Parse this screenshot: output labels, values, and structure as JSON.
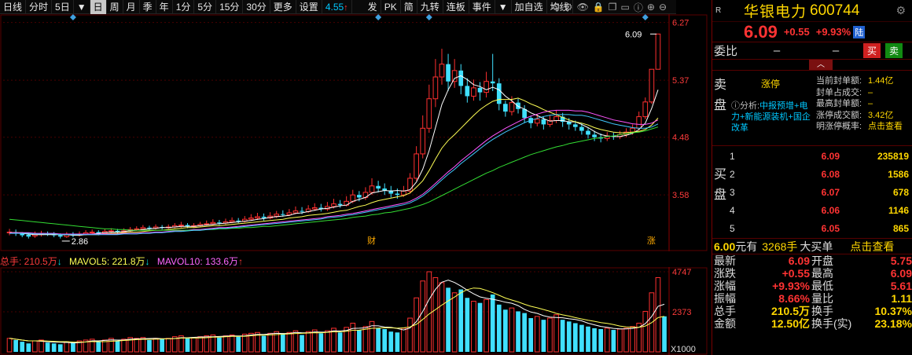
{
  "toolbar": {
    "items": [
      "日线",
      "分时",
      "5日",
      "日",
      "周",
      "月",
      "季",
      "年",
      "1分",
      "5分",
      "15分",
      "30分",
      "更多",
      "设置"
    ],
    "active": "日",
    "price": "4.55",
    "items2": [
      "发",
      "PK",
      "简",
      "九转",
      "连板",
      "事件",
      "加自选",
      "均线"
    ],
    "icons": [
      "settings-icon",
      "eye-icon",
      "lock-icon",
      "copy-icon",
      "comment-icon",
      "info-icon",
      "plus-icon",
      "minus-icon"
    ]
  },
  "chart": {
    "y_labels": [
      "6.27",
      "5.37",
      "4.48",
      "3.58"
    ],
    "high_label": "6.09",
    "low_label": "2.86",
    "event_cai": "财",
    "event_zt": "涨",
    "candles": [
      [
        2.99,
        3.0,
        2.95,
        3.05
      ],
      [
        3.0,
        2.98,
        2.94,
        3.04
      ],
      [
        2.98,
        2.95,
        2.92,
        3.0
      ],
      [
        2.96,
        2.93,
        2.9,
        2.99
      ],
      [
        2.94,
        2.96,
        2.91,
        3.01
      ],
      [
        2.96,
        2.98,
        2.93,
        3.02
      ],
      [
        2.98,
        2.97,
        2.94,
        3.01
      ],
      [
        2.97,
        2.95,
        2.92,
        3.0
      ],
      [
        2.95,
        2.93,
        2.9,
        2.98
      ],
      [
        2.93,
        2.96,
        2.91,
        3.0
      ],
      [
        2.96,
        2.95,
        2.92,
        3.0
      ],
      [
        2.95,
        2.97,
        2.93,
        3.01
      ],
      [
        2.97,
        2.99,
        2.95,
        3.03
      ],
      [
        2.99,
        3.0,
        2.96,
        3.04
      ],
      [
        3.0,
        2.98,
        2.95,
        3.03
      ],
      [
        2.98,
        3.01,
        2.96,
        3.05
      ],
      [
        3.01,
        3.02,
        2.99,
        3.06
      ],
      [
        3.02,
        3.0,
        2.97,
        3.05
      ],
      [
        3.0,
        3.02,
        2.98,
        3.06
      ],
      [
        3.02,
        3.04,
        3.0,
        3.08
      ],
      [
        3.04,
        3.05,
        3.02,
        3.09
      ],
      [
        3.05,
        3.07,
        3.03,
        3.11
      ],
      [
        3.07,
        3.06,
        3.03,
        3.1
      ],
      [
        3.06,
        3.08,
        3.04,
        3.12
      ],
      [
        3.08,
        3.07,
        3.04,
        3.11
      ],
      [
        3.07,
        3.08,
        3.05,
        3.12
      ],
      [
        3.08,
        3.1,
        3.06,
        3.14
      ],
      [
        3.1,
        3.11,
        3.07,
        3.16
      ],
      [
        3.11,
        3.09,
        3.06,
        3.14
      ],
      [
        3.09,
        3.1,
        3.07,
        3.14
      ],
      [
        3.1,
        3.12,
        3.08,
        3.16
      ],
      [
        3.12,
        3.13,
        3.1,
        3.18
      ],
      [
        3.13,
        3.15,
        3.11,
        3.2
      ],
      [
        3.15,
        3.14,
        3.11,
        3.19
      ],
      [
        3.14,
        3.16,
        3.12,
        3.21
      ],
      [
        3.16,
        3.18,
        3.14,
        3.23
      ],
      [
        3.18,
        3.17,
        3.14,
        3.22
      ],
      [
        3.17,
        3.2,
        3.15,
        3.25
      ],
      [
        3.2,
        3.22,
        3.18,
        3.28
      ],
      [
        3.22,
        3.24,
        3.19,
        3.3
      ],
      [
        3.24,
        3.22,
        3.18,
        3.29
      ],
      [
        3.22,
        3.25,
        3.2,
        3.31
      ],
      [
        3.25,
        3.28,
        3.22,
        3.33
      ],
      [
        3.28,
        3.27,
        3.24,
        3.34
      ],
      [
        3.27,
        3.3,
        3.25,
        3.36
      ],
      [
        3.3,
        3.33,
        3.28,
        3.4
      ],
      [
        3.33,
        3.32,
        3.28,
        3.39
      ],
      [
        3.32,
        3.36,
        3.3,
        3.42
      ],
      [
        3.36,
        3.38,
        3.33,
        3.45
      ],
      [
        3.38,
        3.36,
        3.32,
        3.44
      ],
      [
        3.36,
        3.4,
        3.33,
        3.47
      ],
      [
        3.4,
        3.44,
        3.37,
        3.52
      ],
      [
        3.44,
        3.42,
        3.38,
        3.5
      ],
      [
        3.42,
        3.48,
        3.4,
        3.56
      ],
      [
        3.48,
        3.58,
        3.45,
        3.66
      ],
      [
        3.58,
        3.54,
        3.48,
        3.64
      ],
      [
        3.54,
        3.62,
        3.5,
        3.7
      ],
      [
        3.62,
        3.72,
        3.58,
        3.84
      ],
      [
        3.72,
        3.68,
        3.62,
        3.8
      ],
      [
        3.68,
        3.65,
        3.58,
        3.76
      ],
      [
        3.65,
        3.6,
        3.54,
        3.72
      ],
      [
        3.6,
        3.58,
        3.52,
        3.68
      ],
      [
        3.58,
        3.64,
        3.55,
        3.72
      ],
      [
        3.64,
        3.84,
        3.6,
        3.92
      ],
      [
        3.84,
        4.22,
        3.8,
        4.34
      ],
      [
        4.22,
        4.62,
        4.15,
        4.82
      ],
      [
        4.62,
        5.08,
        4.55,
        5.3
      ],
      [
        5.08,
        5.42,
        4.95,
        5.7
      ],
      [
        5.42,
        5.62,
        5.3,
        5.86
      ],
      [
        5.62,
        5.35,
        5.2,
        5.78
      ],
      [
        5.35,
        5.52,
        5.25,
        5.7
      ],
      [
        5.52,
        5.28,
        5.15,
        5.62
      ],
      [
        5.28,
        5.12,
        5.02,
        5.4
      ],
      [
        5.12,
        5.25,
        5.05,
        5.38
      ],
      [
        5.25,
        5.18,
        5.05,
        5.34
      ],
      [
        5.18,
        5.35,
        5.1,
        5.5
      ],
      [
        5.35,
        5.32,
        5.2,
        5.78
      ],
      [
        5.32,
        5.0,
        4.9,
        5.4
      ],
      [
        5.0,
        4.88,
        4.8,
        5.05
      ],
      [
        4.88,
        5.02,
        4.82,
        5.12
      ],
      [
        5.02,
        4.92,
        4.85,
        5.08
      ],
      [
        4.92,
        4.78,
        4.7,
        4.98
      ],
      [
        4.78,
        4.7,
        4.62,
        4.82
      ],
      [
        4.7,
        4.76,
        4.65,
        4.84
      ],
      [
        4.76,
        4.68,
        4.6,
        4.8
      ],
      [
        4.68,
        4.74,
        4.64,
        4.82
      ],
      [
        4.74,
        4.8,
        4.7,
        4.9
      ],
      [
        4.8,
        4.72,
        4.64,
        4.86
      ],
      [
        4.72,
        4.68,
        4.6,
        4.78
      ],
      [
        4.68,
        4.64,
        4.58,
        4.74
      ],
      [
        4.64,
        4.58,
        4.52,
        4.7
      ],
      [
        4.58,
        4.52,
        4.46,
        4.62
      ],
      [
        4.52,
        4.48,
        4.42,
        4.58
      ],
      [
        4.48,
        4.46,
        4.4,
        4.54
      ],
      [
        4.46,
        4.5,
        4.42,
        4.56
      ],
      [
        4.5,
        4.49,
        4.44,
        4.55
      ],
      [
        4.49,
        4.52,
        4.45,
        4.58
      ],
      [
        4.52,
        4.56,
        4.48,
        4.62
      ],
      [
        4.56,
        4.62,
        4.52,
        4.68
      ],
      [
        4.62,
        4.8,
        4.58,
        4.88
      ],
      [
        4.8,
        5.03,
        4.76,
        5.1
      ],
      [
        5.03,
        5.54,
        5.0,
        5.54
      ],
      [
        5.54,
        6.09,
        5.61,
        6.09
      ]
    ],
    "ma_values": {
      "ma5": [
        2.99,
        2.99,
        2.98,
        2.97,
        2.96,
        2.96,
        2.96,
        2.96,
        2.96,
        2.96,
        2.95,
        2.95,
        2.96,
        2.97,
        2.98,
        2.99,
        3.0,
        3.0,
        3.01,
        3.02,
        3.03,
        3.04,
        3.05,
        3.06,
        3.07,
        3.07,
        3.08,
        3.09,
        3.09,
        3.09,
        3.1,
        3.11,
        3.12,
        3.13,
        3.14,
        3.15,
        3.16,
        3.17,
        3.18,
        3.2,
        3.21,
        3.23,
        3.24,
        3.25,
        3.26,
        3.29,
        3.3,
        3.32,
        3.34,
        3.36,
        3.37,
        3.39,
        3.41,
        3.42,
        3.48,
        3.51,
        3.54,
        3.61,
        3.63,
        3.65,
        3.64,
        3.65,
        3.64,
        3.66,
        3.78,
        3.98,
        4.27,
        4.63,
        4.99,
        5.22,
        5.4,
        5.44,
        5.38,
        5.3,
        5.27,
        5.22,
        5.26,
        5.22,
        5.12,
        5.05,
        4.96,
        4.92,
        4.86,
        4.82,
        4.77,
        4.73,
        4.74,
        4.74,
        4.72,
        4.72,
        4.68,
        4.63,
        4.57,
        4.52,
        4.5,
        4.49,
        4.49,
        4.51,
        4.54,
        4.6,
        4.7,
        4.93,
        5.22
      ],
      "ma10": [
        2.99,
        2.99,
        2.99,
        2.98,
        2.98,
        2.97,
        2.97,
        2.97,
        2.96,
        2.96,
        2.96,
        2.96,
        2.96,
        2.96,
        2.96,
        2.97,
        2.98,
        2.98,
        2.99,
        3.0,
        3.0,
        3.01,
        3.02,
        3.03,
        3.03,
        3.04,
        3.05,
        3.06,
        3.07,
        3.07,
        3.08,
        3.09,
        3.1,
        3.1,
        3.11,
        3.12,
        3.13,
        3.14,
        3.15,
        3.16,
        3.17,
        3.18,
        3.19,
        3.2,
        3.22,
        3.23,
        3.24,
        3.26,
        3.27,
        3.28,
        3.29,
        3.31,
        3.33,
        3.34,
        3.37,
        3.4,
        3.42,
        3.46,
        3.49,
        3.51,
        3.53,
        3.55,
        3.57,
        3.61,
        3.7,
        3.8,
        3.96,
        4.14,
        4.31,
        4.43,
        4.52,
        4.62,
        4.72,
        4.82,
        4.91,
        4.98,
        5.04,
        5.07,
        5.07,
        5.07,
        5.09,
        5.05,
        5.0,
        4.96,
        4.91,
        4.87,
        4.83,
        4.79,
        4.75,
        4.72,
        4.7,
        4.67,
        4.63,
        4.6,
        4.58,
        4.56,
        4.55,
        4.55,
        4.56,
        4.57,
        4.6,
        4.67,
        4.78
      ],
      "ma20": [
        2.99,
        2.99,
        2.99,
        2.99,
        2.98,
        2.98,
        2.98,
        2.98,
        2.97,
        2.97,
        2.97,
        2.97,
        2.97,
        2.97,
        2.97,
        2.97,
        2.97,
        2.97,
        2.98,
        2.98,
        2.98,
        2.99,
        2.99,
        3.0,
        3.0,
        3.01,
        3.02,
        3.02,
        3.03,
        3.04,
        3.04,
        3.05,
        3.06,
        3.07,
        3.07,
        3.08,
        3.09,
        3.1,
        3.11,
        3.12,
        3.13,
        3.14,
        3.15,
        3.16,
        3.17,
        3.18,
        3.19,
        3.2,
        3.21,
        3.22,
        3.24,
        3.25,
        3.26,
        3.28,
        3.29,
        3.31,
        3.33,
        3.35,
        3.37,
        3.39,
        3.41,
        3.43,
        3.45,
        3.48,
        3.53,
        3.59,
        3.67,
        3.76,
        3.85,
        3.94,
        4.02,
        4.11,
        4.19,
        4.27,
        4.35,
        4.43,
        4.5,
        4.56,
        4.62,
        4.67,
        4.72,
        4.77,
        4.81,
        4.84,
        4.87,
        4.89,
        4.9,
        4.9,
        4.9,
        4.89,
        4.89,
        4.87,
        4.84,
        4.81,
        4.78,
        4.75,
        4.73,
        4.71,
        4.69,
        4.68,
        4.68,
        4.7,
        4.75
      ],
      "ma60": [
        3.2,
        3.19,
        3.18,
        3.17,
        3.16,
        3.15,
        3.14,
        3.13,
        3.12,
        3.11,
        3.1,
        3.09,
        3.08,
        3.07,
        3.06,
        3.05,
        3.05,
        3.04,
        3.04,
        3.03,
        3.03,
        3.03,
        3.03,
        3.03,
        3.03,
        3.03,
        3.03,
        3.03,
        3.03,
        3.03,
        3.03,
        3.04,
        3.04,
        3.05,
        3.05,
        3.06,
        3.06,
        3.07,
        3.07,
        3.08,
        3.09,
        3.09,
        3.1,
        3.11,
        3.12,
        3.13,
        3.14,
        3.15,
        3.16,
        3.17,
        3.18,
        3.19,
        3.2,
        3.21,
        3.23,
        3.24,
        3.25,
        3.27,
        3.28,
        3.3,
        3.31,
        3.33,
        3.35,
        3.37,
        3.4,
        3.43,
        3.47,
        3.52,
        3.57,
        3.62,
        3.67,
        3.72,
        3.77,
        3.82,
        3.87,
        3.92,
        3.96,
        4.01,
        4.05,
        4.09,
        4.13,
        4.17,
        4.21,
        4.24,
        4.27,
        4.3,
        4.33,
        4.35,
        4.38,
        4.4,
        4.42,
        4.44,
        4.46,
        4.47,
        4.49,
        4.5,
        4.52,
        4.53,
        4.55,
        4.56,
        4.58,
        4.61,
        4.64
      ]
    }
  },
  "vol": {
    "header_total": "总手: 210.5万",
    "header_ma5": "MAVOL5: 221.8万",
    "header_ma10": "MAVOL10: 133.6万",
    "y_labels": [
      "4747",
      "2373",
      "X1000"
    ],
    "values": [
      800,
      700,
      600,
      500,
      650,
      700,
      550,
      500,
      450,
      600,
      550,
      650,
      700,
      750,
      600,
      700,
      800,
      650,
      750,
      850,
      800,
      850,
      700,
      800,
      750,
      800,
      900,
      950,
      800,
      850,
      900,
      950,
      1000,
      850,
      950,
      1000,
      900,
      1050,
      1100,
      1150,
      950,
      1100,
      1200,
      1050,
      1150,
      1250,
      1000,
      1200,
      1300,
      1100,
      1250,
      1400,
      1150,
      1450,
      1700,
      1300,
      1500,
      1800,
      1400,
      1350,
      1200,
      1150,
      1400,
      2000,
      3200,
      4200,
      4747,
      4400,
      4100,
      3800,
      3500,
      3700,
      3200,
      3000,
      2900,
      3100,
      3400,
      2800,
      2500,
      2600,
      2400,
      2300,
      2000,
      2100,
      1900,
      2000,
      2200,
      1900,
      1800,
      1700,
      1600,
      1500,
      1400,
      1350,
      1400,
      1300,
      1350,
      1400,
      1500,
      1700,
      2400,
      3500,
      4400,
      2105
    ],
    "ups": [
      1,
      0,
      0,
      0,
      1,
      1,
      0,
      0,
      0,
      1,
      0,
      1,
      1,
      1,
      0,
      1,
      1,
      0,
      1,
      1,
      1,
      1,
      0,
      1,
      0,
      1,
      1,
      1,
      0,
      1,
      1,
      1,
      1,
      0,
      1,
      1,
      0,
      1,
      1,
      1,
      0,
      1,
      1,
      0,
      1,
      1,
      0,
      1,
      1,
      0,
      1,
      1,
      0,
      1,
      1,
      0,
      1,
      1,
      0,
      0,
      0,
      0,
      1,
      1,
      1,
      1,
      1,
      1,
      1,
      0,
      1,
      0,
      0,
      1,
      0,
      1,
      0,
      0,
      0,
      1,
      0,
      0,
      0,
      1,
      0,
      1,
      1,
      0,
      0,
      0,
      0,
      0,
      0,
      0,
      1,
      0,
      1,
      1,
      1,
      1,
      1,
      1,
      1
    ]
  },
  "panel": {
    "r_label": "R",
    "name": "华银电力",
    "code": "600744",
    "last": "6.09",
    "change": "+0.55",
    "pct": "+9.93%",
    "lu": "陆",
    "weibi_label": "委比",
    "weibi_v1": "–",
    "weibi_v2": "–",
    "buy_btn": "买",
    "sell_btn": "卖",
    "sell_label": "卖盘",
    "zt_title": "涨停",
    "analysis_prefix": "分析:",
    "analysis_tags": "中报预增+电力+新能源装机+国企改革",
    "zt_info": [
      {
        "k": "当前封单额:",
        "v": "1.44亿"
      },
      {
        "k": "封单占成交:",
        "v": "–"
      },
      {
        "k": "最高封单额:",
        "v": "–"
      },
      {
        "k": "涨停成交额:",
        "v": "3.42亿"
      },
      {
        "k": "明涨停概率:",
        "v": "点击查看"
      }
    ],
    "buy_label": "买盘",
    "bids": [
      {
        "lvl": "1",
        "px": "6.09",
        "vol": "235819"
      },
      {
        "lvl": "2",
        "px": "6.08",
        "vol": "1586"
      },
      {
        "lvl": "3",
        "px": "6.07",
        "vol": "678"
      },
      {
        "lvl": "4",
        "px": "6.06",
        "vol": "1146"
      },
      {
        "lvl": "5",
        "px": "6.05",
        "vol": "865"
      }
    ],
    "big_price": "6.00",
    "big_yuan": "元有",
    "big_vol": "3268手",
    "big_label": "大买单",
    "big_link": "点击查看",
    "stats": [
      {
        "k1": "最新",
        "v1": "6.09",
        "k2": "开盘",
        "v2": "5.75"
      },
      {
        "k1": "涨跌",
        "v1": "+0.55",
        "k2": "最高",
        "v2": "6.09"
      },
      {
        "k1": "涨幅",
        "v1": "+9.93%",
        "k2": "最低",
        "v2": "5.61"
      },
      {
        "k1": "振幅",
        "v1": "8.66%",
        "k2": "量比",
        "v2": "1.11"
      },
      {
        "k1": "总手",
        "v1": "210.5万",
        "k2": "换手",
        "v2": "10.37%"
      },
      {
        "k1": "金额",
        "v1": "12.50亿",
        "k2": "换手(实)",
        "v2": "23.18%"
      }
    ]
  }
}
